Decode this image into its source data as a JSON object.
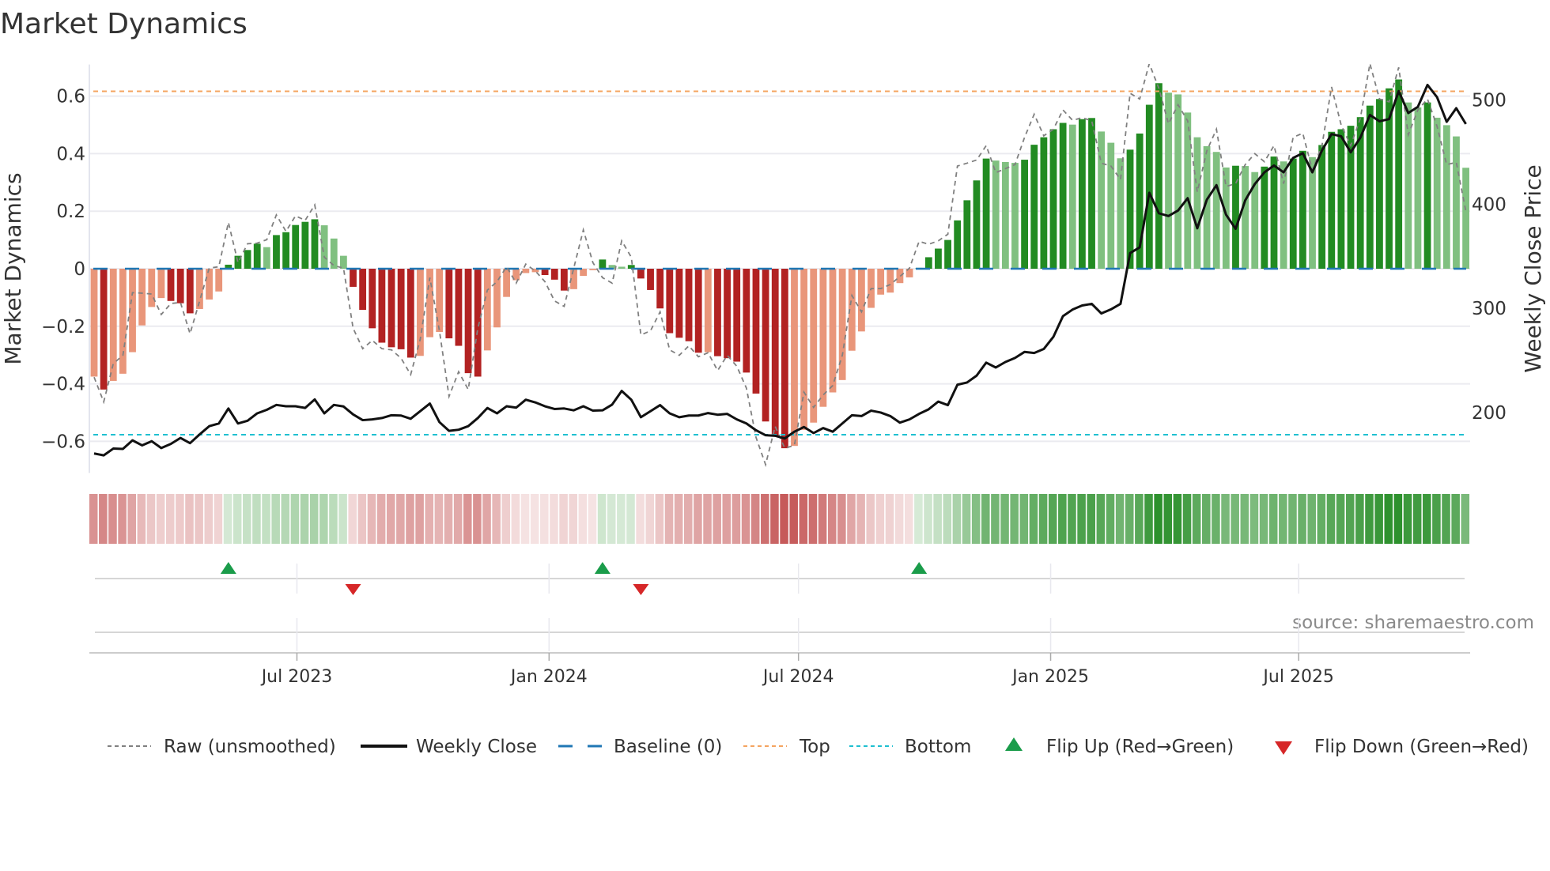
{
  "chart_data": {
    "type": "bar",
    "title": "Market Dynamics",
    "ylabel": "Market Dynamics",
    "y2label": "Weekly Close Price",
    "ylim": [
      -0.71,
      0.71
    ],
    "y2lim": [
      142,
      534
    ],
    "yticks": [
      -0.6,
      -0.4,
      -0.2,
      0,
      0.2,
      0.4,
      0.6
    ],
    "ytick_labels": [
      "−0.6",
      "−0.4",
      "−0.2",
      "0",
      "0.2",
      "0.4",
      "0.6"
    ],
    "y2ticks": [
      200,
      300,
      400,
      500
    ],
    "y2tick_labels": [
      "200",
      "300",
      "400",
      "500"
    ],
    "start_date": "2023-02-03",
    "frequency": "weekly",
    "xticks": [
      {
        "date": "2023-07-01",
        "label": "Jul 2023"
      },
      {
        "date": "2024-01-01",
        "label": "Jan 2024"
      },
      {
        "date": "2024-07-01",
        "label": "Jul 2024"
      },
      {
        "date": "2025-01-01",
        "label": "Jan 2025"
      },
      {
        "date": "2025-07-01",
        "label": "Jul 2025"
      }
    ],
    "top_level": 0.617,
    "bottom_level": -0.577,
    "baseline": 0,
    "grid": true,
    "legend_position": "bottom",
    "source": "source: sharemaestro.com",
    "smoothed": [
      -0.375,
      -0.42,
      -0.39,
      -0.365,
      -0.29,
      -0.197,
      -0.133,
      -0.102,
      -0.112,
      -0.12,
      -0.155,
      -0.14,
      -0.107,
      -0.079,
      0.014,
      0.045,
      0.065,
      0.087,
      0.075,
      0.117,
      0.127,
      0.152,
      0.163,
      0.172,
      0.151,
      0.105,
      0.045,
      -0.063,
      -0.143,
      -0.207,
      -0.257,
      -0.273,
      -0.28,
      -0.309,
      -0.303,
      -0.238,
      -0.22,
      -0.242,
      -0.268,
      -0.363,
      -0.375,
      -0.284,
      -0.204,
      -0.098,
      -0.04,
      -0.015,
      -0.012,
      -0.022,
      -0.038,
      -0.076,
      -0.071,
      -0.025,
      -0.005,
      0.032,
      0.013,
      0.007,
      0.013,
      -0.034,
      -0.074,
      -0.138,
      -0.224,
      -0.24,
      -0.252,
      -0.292,
      -0.29,
      -0.304,
      -0.311,
      -0.323,
      -0.361,
      -0.434,
      -0.531,
      -0.58,
      -0.624,
      -0.616,
      -0.56,
      -0.535,
      -0.48,
      -0.43,
      -0.387,
      -0.285,
      -0.218,
      -0.136,
      -0.09,
      -0.083,
      -0.05,
      -0.03,
      0.003,
      0.04,
      0.07,
      0.1,
      0.168,
      0.238,
      0.307,
      0.383,
      0.376,
      0.371,
      0.368,
      0.379,
      0.431,
      0.457,
      0.485,
      0.507,
      0.501,
      0.52,
      0.524,
      0.477,
      0.438,
      0.384,
      0.414,
      0.47,
      0.57,
      0.645,
      0.612,
      0.606,
      0.543,
      0.457,
      0.426,
      0.406,
      0.352,
      0.358,
      0.357,
      0.336,
      0.355,
      0.39,
      0.373,
      0.383,
      0.41,
      0.388,
      0.43,
      0.476,
      0.485,
      0.497,
      0.527,
      0.567,
      0.59,
      0.627,
      0.658,
      0.578,
      0.561,
      0.578,
      0.525,
      0.499,
      0.46,
      0.351
    ],
    "raw": [
      -0.377,
      -0.463,
      -0.33,
      -0.301,
      -0.083,
      -0.085,
      -0.088,
      -0.159,
      -0.121,
      -0.117,
      -0.226,
      -0.112,
      0.002,
      0.007,
      0.161,
      0.021,
      0.087,
      0.089,
      0.101,
      0.187,
      0.13,
      0.184,
      0.168,
      0.222,
      0.04,
      0.011,
      0.002,
      -0.207,
      -0.278,
      -0.249,
      -0.278,
      -0.282,
      -0.311,
      -0.368,
      -0.245,
      -0.031,
      -0.216,
      -0.444,
      -0.358,
      -0.42,
      -0.207,
      -0.074,
      -0.045,
      0.007,
      -0.05,
      0.016,
      -0.008,
      -0.045,
      -0.112,
      -0.131,
      0.002,
      0.135,
      0.021,
      -0.031,
      -0.05,
      0.097,
      0.04,
      -0.23,
      -0.216,
      -0.15,
      -0.282,
      -0.301,
      -0.268,
      -0.306,
      -0.292,
      -0.354,
      -0.301,
      -0.339,
      -0.415,
      -0.586,
      -0.681,
      -0.548,
      -0.624,
      -0.614,
      -0.429,
      -0.482,
      -0.439,
      -0.406,
      -0.301,
      -0.093,
      -0.15,
      -0.069,
      -0.069,
      -0.055,
      -0.027,
      0.002,
      0.095,
      0.085,
      0.097,
      0.12,
      0.357,
      0.367,
      0.378,
      0.428,
      0.334,
      0.348,
      0.362,
      0.457,
      0.537,
      0.462,
      0.485,
      0.552,
      0.516,
      0.525,
      0.514,
      0.367,
      0.357,
      0.31,
      0.61,
      0.59,
      0.713,
      0.627,
      0.504,
      0.57,
      0.514,
      0.267,
      0.41,
      0.485,
      0.286,
      0.296,
      0.362,
      0.4,
      0.372,
      0.428,
      0.296,
      0.457,
      0.471,
      0.343,
      0.428,
      0.632,
      0.5,
      0.428,
      0.523,
      0.713,
      0.59,
      0.58,
      0.7,
      0.466,
      0.552,
      0.59,
      0.495,
      0.362,
      0.37,
      0.2
    ],
    "close": [
      160.7,
      158.9,
      165.4,
      165.1,
      173.3,
      168.5,
      172.5,
      165.9,
      169.9,
      175.6,
      170.6,
      179.0,
      186.9,
      189.5,
      203.9,
      189.5,
      192.1,
      199.2,
      202.6,
      207.3,
      206.0,
      206.0,
      204.4,
      212.6,
      199.2,
      207.3,
      205.8,
      198.2,
      192.7,
      193.4,
      194.7,
      197.4,
      197.1,
      194.0,
      201.3,
      208.6,
      190.8,
      182.4,
      183.5,
      186.9,
      194.7,
      204.4,
      199.2,
      206.0,
      204.7,
      212.3,
      209.7,
      206.0,
      203.4,
      203.9,
      202.1,
      206.0,
      201.8,
      202.1,
      207.6,
      220.7,
      212.3,
      195.5,
      201.3,
      207.1,
      199.2,
      195.5,
      197.1,
      197.1,
      199.5,
      197.9,
      198.7,
      193.4,
      189.5,
      183.0,
      178.2,
      177.7,
      175.1,
      181.6,
      186.1,
      180.3,
      185.1,
      181.6,
      189.5,
      197.4,
      196.6,
      201.8,
      200.0,
      196.6,
      190.3,
      193.4,
      198.7,
      203.1,
      210.5,
      207.1,
      226.7,
      228.8,
      235.4,
      247.9,
      243.2,
      248.5,
      252.4,
      258.2,
      257.1,
      261.0,
      272.6,
      292.5,
      298.8,
      302.7,
      304.3,
      295.1,
      299.0,
      304.3,
      353.0,
      358.5,
      410.9,
      391.2,
      388.6,
      393.9,
      405.7,
      376.8,
      404.3,
      418.2,
      389.9,
      376.3,
      403.6,
      419.3,
      430.5,
      437.1,
      430.5,
      444.4,
      448.9,
      430.5,
      451.5,
      467.2,
      465.1,
      449.7,
      463.8,
      485.6,
      479.5,
      481.6,
      508.4,
      487.4,
      493.4,
      514.4,
      502.6,
      479.0,
      492.1,
      476.9
    ],
    "legend": [
      {
        "key": "raw",
        "label": "Raw (unsmoothed)"
      },
      {
        "key": "close",
        "label": "Weekly Close"
      },
      {
        "key": "baseline",
        "label": "Baseline (0)"
      },
      {
        "key": "top",
        "label": "Top"
      },
      {
        "key": "bottom",
        "label": "Bottom"
      },
      {
        "key": "flip_up",
        "label": "Flip Up (Red→Green)"
      },
      {
        "key": "flip_down",
        "label": "Flip Down (Green→Red)"
      }
    ],
    "colors": {
      "neg_falling": "#b22222",
      "neg_rising": "#e9967a",
      "pos_rising": "#228b22",
      "pos_falling": "#80c080",
      "raw": "#808080",
      "close": "#111111",
      "baseline": "#1f77b4",
      "top": "#f4a460",
      "bottom": "#1fc0d0",
      "flip_up": "#1a9c4a",
      "flip_down": "#d62728",
      "grid": "#ebebf0"
    }
  }
}
